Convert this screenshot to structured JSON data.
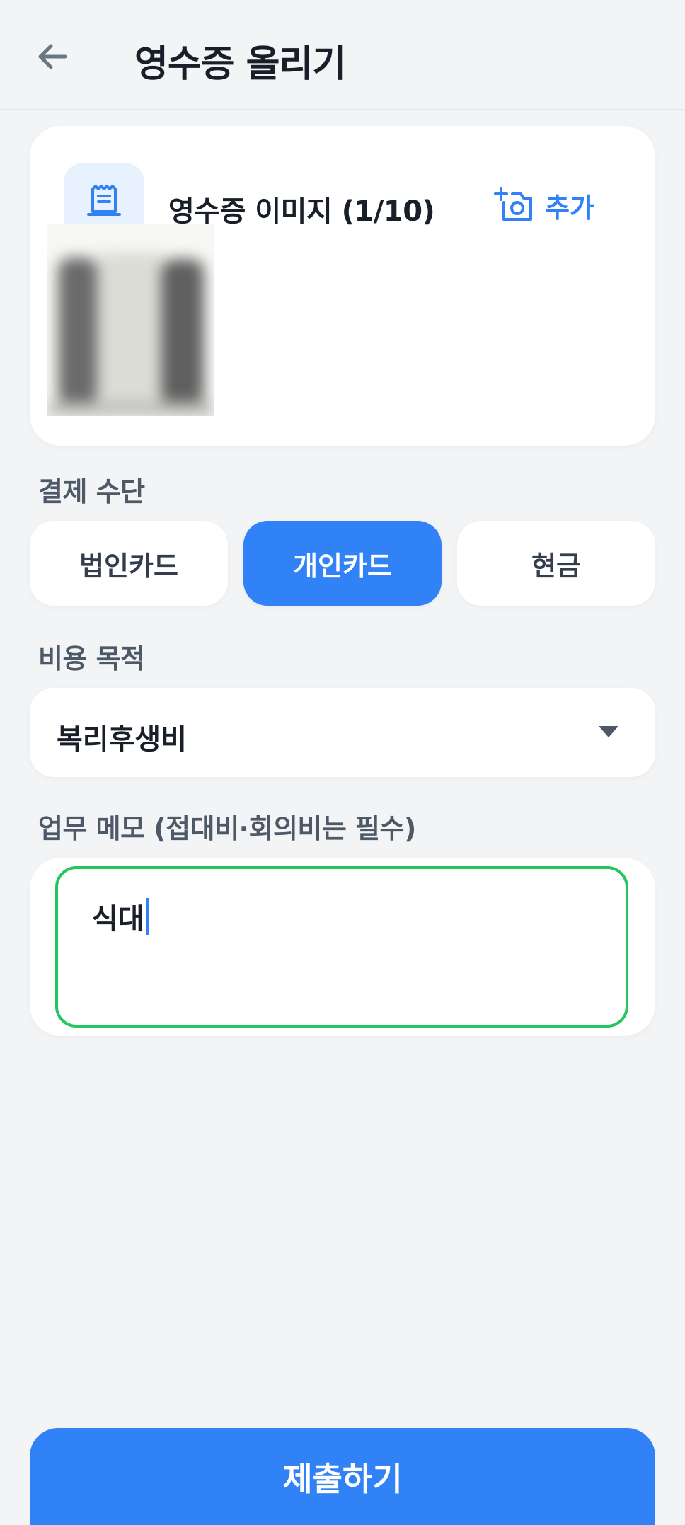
{
  "header": {
    "title": "영수증 올리기",
    "back_icon": "arrow-left-icon"
  },
  "image_section": {
    "title": "영수증 이미지 (1/10)",
    "add_label": "추가",
    "icon": "receipt-icon",
    "add_icon": "camera-plus-icon"
  },
  "payment": {
    "label": "결제 수단",
    "options": [
      "법인카드",
      "개인카드",
      "현금"
    ],
    "selected": "개인카드"
  },
  "purpose": {
    "label": "비용 목적",
    "value": "복리후생비"
  },
  "memo": {
    "label": "업무 메모 (접대비·회의비는 필수)",
    "value": "식대"
  },
  "submit": {
    "label": "제출하기"
  },
  "colors": {
    "primary": "#3182f6",
    "focus_border": "#22c55e",
    "background": "#f2f4f6"
  }
}
